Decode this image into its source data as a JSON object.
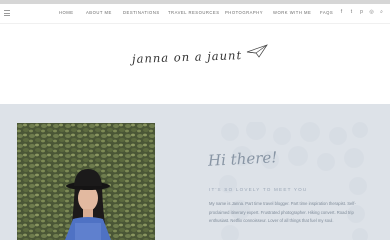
{
  "nav": {
    "items": [
      {
        "label": "HOME"
      },
      {
        "label": "ABOUT ME"
      },
      {
        "label": "DESTINATIONS"
      },
      {
        "label": "TRAVEL RESOURCES"
      },
      {
        "label": "PHOTOGRAPHY"
      },
      {
        "label": "WORK WITH ME"
      },
      {
        "label": "FAQS"
      }
    ],
    "social_icons": [
      "facebook-icon",
      "twitter-icon",
      "pinterest-icon",
      "instagram-icon",
      "search-icon"
    ],
    "social_glyphs": [
      "f",
      "t",
      "p",
      "◎",
      "⌕"
    ]
  },
  "header": {
    "logo_text": "janna on a jaunt"
  },
  "about": {
    "greeting": "Hi there!",
    "subtitle": "IT'S SO LOVELY TO MEET YOU",
    "bio": "My name is Janna. Part time travel blogger. Part time inspiration therapist. Self-proclaimed itinerary expert. Frustrated photographer. Hiking convert. Road trip enthusiast. Netflix connoisseur. Lover of all things that fuel my soul."
  },
  "colors": {
    "section_bg": "#dde2e8",
    "accent": "#8895a4"
  }
}
